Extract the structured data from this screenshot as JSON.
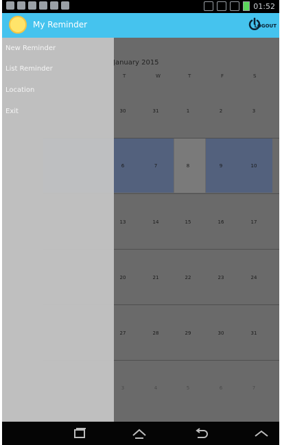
{
  "status_bar": {
    "time": "01:52"
  },
  "app_bar": {
    "title": "My Reminder",
    "logout_label": "LOGOUT"
  },
  "drawer": {
    "items": [
      {
        "label": "New Reminder"
      },
      {
        "label": "List Reminder"
      },
      {
        "label": "Location"
      },
      {
        "label": "Exit"
      }
    ]
  },
  "calendar": {
    "month": "January 2015",
    "weekdays": [
      "T",
      "W",
      "T",
      "F",
      "S"
    ],
    "weeks": [
      [
        "30",
        "31",
        "1",
        "2",
        "3"
      ],
      [
        "6",
        "7",
        "8",
        "9",
        "10"
      ],
      [
        "13",
        "14",
        "15",
        "16",
        "17"
      ],
      [
        "20",
        "21",
        "22",
        "23",
        "24"
      ],
      [
        "27",
        "28",
        "29",
        "30",
        "31"
      ],
      [
        "3",
        "4",
        "5",
        "6",
        "7"
      ]
    ]
  },
  "colors": {
    "app_bar": "#45c3ee",
    "highlight": "#4f5f80"
  }
}
